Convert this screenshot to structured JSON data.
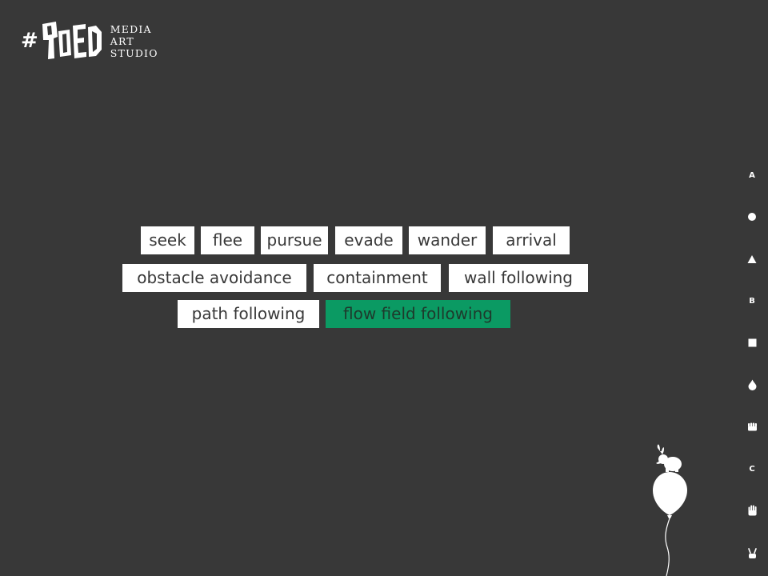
{
  "logo": {
    "hash": "#",
    "mark_text": "90ED",
    "lines": [
      "MEDIA",
      "ART",
      "STUDIO"
    ]
  },
  "behaviors": [
    {
      "label": "seek",
      "active": false
    },
    {
      "label": "flee",
      "active": false
    },
    {
      "label": "pursue",
      "active": false
    },
    {
      "label": "evade",
      "active": false
    },
    {
      "label": "wander",
      "active": false
    },
    {
      "label": "arrival",
      "active": false
    },
    {
      "label": "obstacle avoidance",
      "active": false
    },
    {
      "label": "containment",
      "active": false
    },
    {
      "label": "wall following",
      "active": false
    },
    {
      "label": "path following",
      "active": false
    },
    {
      "label": "flow field following",
      "active": true
    }
  ],
  "side_nav": [
    {
      "type": "letter",
      "label": "A"
    },
    {
      "type": "icon",
      "icon": "circle-icon"
    },
    {
      "type": "icon",
      "icon": "triangle-icon"
    },
    {
      "type": "letter",
      "label": "B"
    },
    {
      "type": "icon",
      "icon": "square-icon"
    },
    {
      "type": "icon",
      "icon": "drop-icon"
    },
    {
      "type": "icon",
      "icon": "fist-icon"
    },
    {
      "type": "letter",
      "label": "C"
    },
    {
      "type": "icon",
      "icon": "open-hand-icon"
    },
    {
      "type": "icon",
      "icon": "peace-hand-icon"
    }
  ],
  "colors": {
    "background": "#383838",
    "button_bg": "#ffffff",
    "button_text": "#383838",
    "active_bg": "#0b9a63",
    "active_text": "#1e3a2c"
  }
}
